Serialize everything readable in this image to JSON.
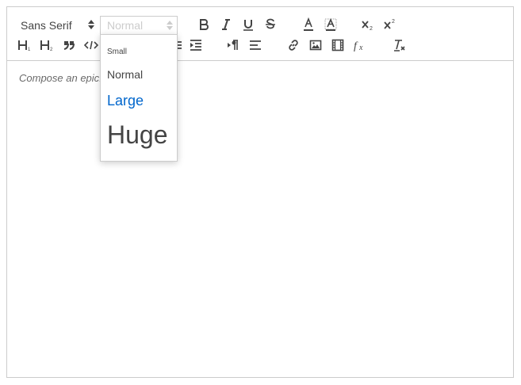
{
  "toolbar": {
    "font_picker": {
      "selected": "Sans Serif"
    },
    "size_picker": {
      "selected": "Normal",
      "options": [
        "Small",
        "Normal",
        "Large",
        "Huge"
      ],
      "highlighted_option": "Large"
    },
    "header_buttons": [
      "H1",
      "H2"
    ],
    "icons": [
      "bold-icon",
      "italic-icon",
      "underline-icon",
      "strike-icon",
      "text-color-icon",
      "background-color-icon",
      "subscript-icon",
      "superscript-icon",
      "header-1-icon",
      "header-2-icon",
      "blockquote-icon",
      "code-block-icon",
      "indent-icon",
      "text-direction-icon",
      "align-icon",
      "link-icon",
      "image-icon",
      "video-icon",
      "formula-icon",
      "clean-format-icon"
    ]
  },
  "editor": {
    "placeholder": "Compose an epic..."
  },
  "colors": {
    "border": "#cccccc",
    "icon": "#444444",
    "active": "#0066cc"
  }
}
